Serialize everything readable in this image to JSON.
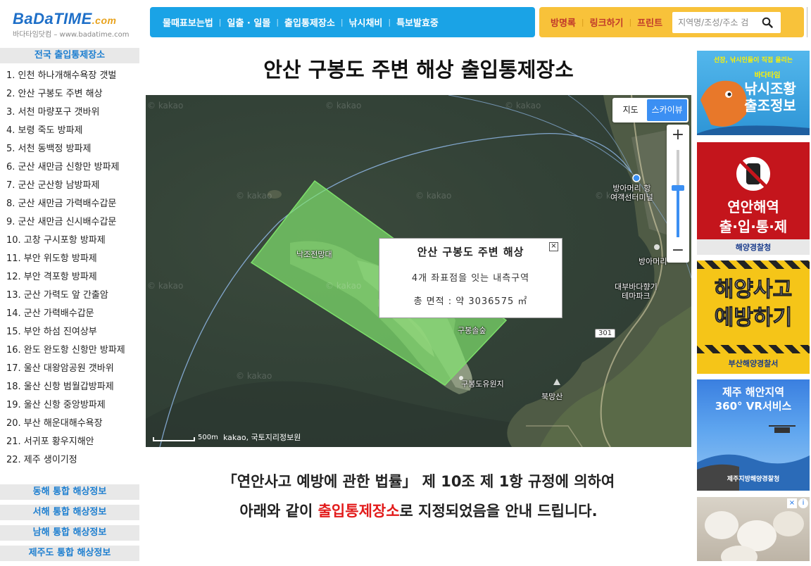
{
  "header": {
    "logo_main": "BaDaTIME",
    "logo_suffix": ".com",
    "logo_sub": "바다타임닷컴 – www.badatime.com",
    "nav_blue": [
      "물때표보는법",
      "일출 · 일몰",
      "출입통제장소",
      "낚시채비",
      "특보발효중"
    ],
    "nav_yellow": [
      "방명록",
      "링크하기",
      "프린트"
    ],
    "search_placeholder": "지역명/조성/주소 검"
  },
  "sidebar": {
    "title": "전국 출입통제장소",
    "items": [
      "1. 인천 하나개해수욕장 갯벌",
      "2. 안산 구봉도 주변 해상",
      "3. 서천 마량포구 갯바위",
      "4. 보령 죽도 방파제",
      "5. 서천 동백정 방파제",
      "6. 군산 새만금 신항만 방파제",
      "7. 군산 군산항 남방파제",
      "8. 군산 새만금 가력배수갑문",
      "9. 군산 새만금 신시배수갑문",
      "10. 고창 구시포항 방파제",
      "11. 부안 위도항 방파제",
      "12. 부안 격포항 방파제",
      "13. 군산 가력도 앞 간출암",
      "14. 군산 가력배수갑문",
      "15. 부안 하섬 진여상부",
      "16. 완도 완도항 신항만 방파제",
      "17. 울산 대왕암공원 갯바위",
      "18. 울산 신항 범월갑방파제",
      "19. 울산 신항 중앙방파제",
      "20. 부산 해운대해수욕장",
      "21. 서귀포 황우지해안",
      "22. 제주 생이기정"
    ],
    "sections": [
      "동해 통합 해상정보",
      "서해 통합 해상정보",
      "남해 통합 해상정보",
      "제주도 통합 해상정보"
    ]
  },
  "main": {
    "title": "안산 구봉도 주변 해상 출입통제장소",
    "map": {
      "type_map": "지도",
      "type_sky": "스카이뷰",
      "labels": {
        "ferry": "방아머리 항\n여객선터미널",
        "bangamori": "방아머리",
        "theme": "대부바다향기\n테마파크",
        "nakjo": "낙조전망대",
        "gubong_forest": "구봉솔숲",
        "gubong_resort": "구봉도유원지",
        "bukmang": "북망산",
        "road": "301"
      },
      "watermark": "© kakao",
      "scale": "500m",
      "copyright": "kakao, 국토지리정보원",
      "info": {
        "title": "안산 구봉도 주변 해상",
        "desc": "4개 좌표점을 잇는 내측구역",
        "area_prefix": "총 면적 : 약 3036575",
        "area_unit": "㎡"
      }
    },
    "law_line1": "「연안사고 예방에 관한 법률」 제 10조 제 1항 규정에 의하여",
    "law_line2_a": "아래와 같이 ",
    "law_line2_red": "출입통제장소",
    "law_line2_b": "로 지정되었음을 안내 드립니다."
  },
  "banners": {
    "b1_top": "선장, 낚시인들이 직접 올리는",
    "b1_mid": "바다타임",
    "b1_main": "낚시조황\n출조정보",
    "b2_main": "연안해역\n출·입·통·제",
    "b2_org": "해양경찰청",
    "b3_main": "해양사고\n예방하기",
    "b3_org": "부산해양경찰서",
    "b4_main": "제주 해안지역\n360° VR서비스",
    "b4_org": "제주지방해양경찰청"
  }
}
